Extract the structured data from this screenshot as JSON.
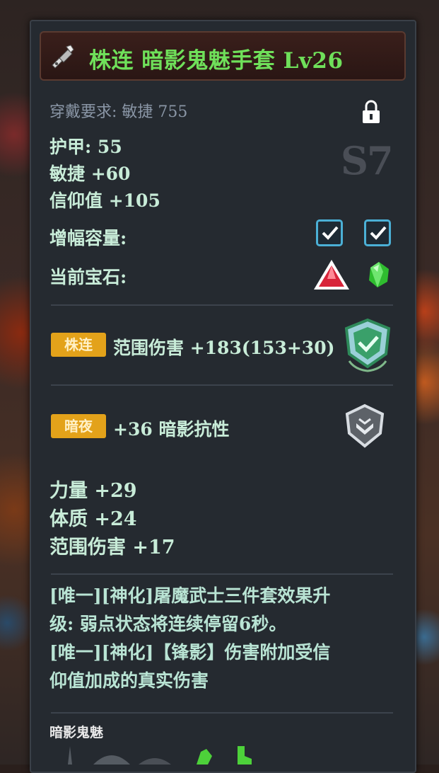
{
  "item": {
    "title": "株连 暗影鬼魅手套 Lv26",
    "requirement": "穿戴要求: 敏捷 755",
    "grade": "S7",
    "stats": [
      "护甲: 55",
      "敏捷 +60",
      "信仰值 +105"
    ],
    "amplify_label": "增幅容量:",
    "gem_label": "当前宝石:",
    "affixes": [
      {
        "tag": "株连",
        "text": "范围伤害 +183(153+30)"
      },
      {
        "tag": "暗夜",
        "text": "+36 暗影抗性"
      }
    ],
    "bonus_stats": [
      "力量 +29",
      "体质 +24",
      "范围伤害 +17"
    ],
    "description": [
      "[唯一][神化]屠魔武士三件套效果升",
      "级: 弱点状态将连续停留6秒。",
      "[唯一][神化]【锋影】伤害附加受信",
      "仰值加成的真实伤害"
    ],
    "set_name": "暗影鬼魅"
  },
  "colors": {
    "title": "#6fe05a",
    "stat_text": "#c8ecd8",
    "tag_bg": "#e3a21a",
    "checkbox": "#4bb0d6"
  }
}
